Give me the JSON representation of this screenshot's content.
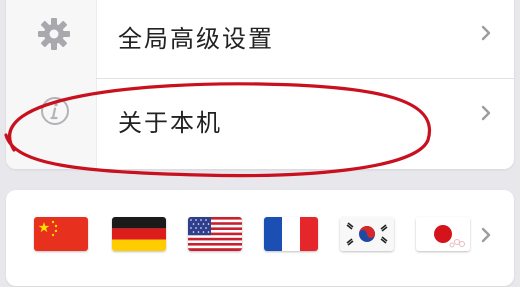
{
  "settings": {
    "items": [
      {
        "label": "全局高级设置",
        "icon": "gear-icon"
      },
      {
        "label": "关于本机",
        "icon": "info-icon"
      }
    ]
  },
  "languages": {
    "flags": [
      "china-flag",
      "germany-flag",
      "usa-flag",
      "france-flag",
      "south-korea-flag",
      "japan-flag"
    ]
  },
  "colors": {
    "annotation": "#c8101e",
    "icon_gray": "#a9a9ad",
    "chevron_gray": "#9c9ca1"
  }
}
